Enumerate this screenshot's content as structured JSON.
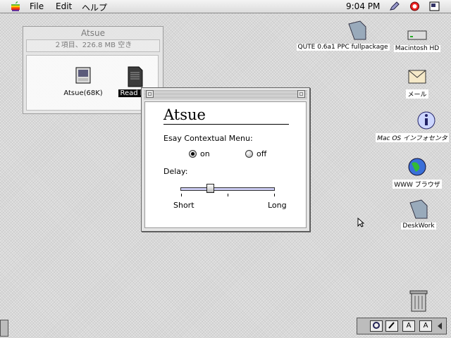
{
  "menubar": {
    "items": [
      "File",
      "Edit",
      "ヘルプ"
    ],
    "clock": "9:04 PM",
    "icons": [
      "apple-icon",
      "pencil-icon",
      "help-icon",
      "application-icon"
    ]
  },
  "finder": {
    "title": "Atsue",
    "info": "２項目、226.8 MB 空き",
    "items": [
      {
        "label": "Atsue(68K)",
        "icon": "application-icon"
      },
      {
        "label": "Read Me",
        "icon": "document-icon"
      }
    ]
  },
  "dialog": {
    "title": "Atsue",
    "menu_label": "Esay Contextual Menu:",
    "on_label": "on",
    "off_label": "off",
    "selected": "on",
    "delay_label": "Delay:",
    "short_label": "Short",
    "long_label": "Long",
    "delay_value": 0.3
  },
  "desktop": {
    "icons": [
      {
        "label": "QUTE 0.6a1 PPC fullpackage",
        "icon": "folder-icon"
      },
      {
        "label": "Macintosh HD",
        "icon": "hard-drive-icon"
      },
      {
        "label": "メール",
        "icon": "mail-icon"
      },
      {
        "label": "Mac OS インフォセンタ",
        "icon": "info-icon"
      },
      {
        "label": "WWW ブラウザ",
        "icon": "globe-icon"
      },
      {
        "label": "DeskWork",
        "icon": "folder-icon"
      },
      {
        "label": "",
        "icon": "trash-icon"
      }
    ]
  },
  "control_strip": {
    "buttons": [
      "A",
      "A"
    ]
  }
}
